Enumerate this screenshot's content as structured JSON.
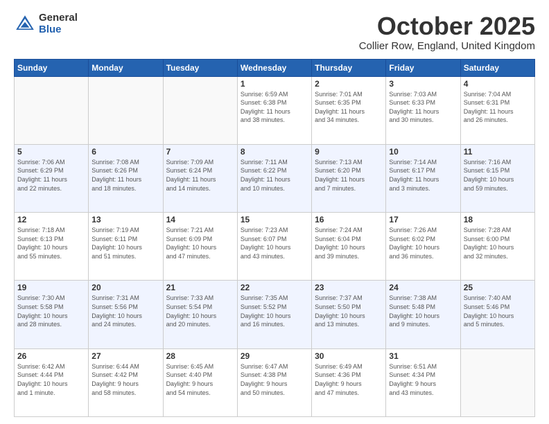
{
  "logo": {
    "general": "General",
    "blue": "Blue"
  },
  "header": {
    "month": "October 2025",
    "location": "Collier Row, England, United Kingdom"
  },
  "weekdays": [
    "Sunday",
    "Monday",
    "Tuesday",
    "Wednesday",
    "Thursday",
    "Friday",
    "Saturday"
  ],
  "weeks": [
    [
      {
        "day": "",
        "info": ""
      },
      {
        "day": "",
        "info": ""
      },
      {
        "day": "",
        "info": ""
      },
      {
        "day": "1",
        "info": "Sunrise: 6:59 AM\nSunset: 6:38 PM\nDaylight: 11 hours\nand 38 minutes."
      },
      {
        "day": "2",
        "info": "Sunrise: 7:01 AM\nSunset: 6:35 PM\nDaylight: 11 hours\nand 34 minutes."
      },
      {
        "day": "3",
        "info": "Sunrise: 7:03 AM\nSunset: 6:33 PM\nDaylight: 11 hours\nand 30 minutes."
      },
      {
        "day": "4",
        "info": "Sunrise: 7:04 AM\nSunset: 6:31 PM\nDaylight: 11 hours\nand 26 minutes."
      }
    ],
    [
      {
        "day": "5",
        "info": "Sunrise: 7:06 AM\nSunset: 6:29 PM\nDaylight: 11 hours\nand 22 minutes."
      },
      {
        "day": "6",
        "info": "Sunrise: 7:08 AM\nSunset: 6:26 PM\nDaylight: 11 hours\nand 18 minutes."
      },
      {
        "day": "7",
        "info": "Sunrise: 7:09 AM\nSunset: 6:24 PM\nDaylight: 11 hours\nand 14 minutes."
      },
      {
        "day": "8",
        "info": "Sunrise: 7:11 AM\nSunset: 6:22 PM\nDaylight: 11 hours\nand 10 minutes."
      },
      {
        "day": "9",
        "info": "Sunrise: 7:13 AM\nSunset: 6:20 PM\nDaylight: 11 hours\nand 7 minutes."
      },
      {
        "day": "10",
        "info": "Sunrise: 7:14 AM\nSunset: 6:17 PM\nDaylight: 11 hours\nand 3 minutes."
      },
      {
        "day": "11",
        "info": "Sunrise: 7:16 AM\nSunset: 6:15 PM\nDaylight: 10 hours\nand 59 minutes."
      }
    ],
    [
      {
        "day": "12",
        "info": "Sunrise: 7:18 AM\nSunset: 6:13 PM\nDaylight: 10 hours\nand 55 minutes."
      },
      {
        "day": "13",
        "info": "Sunrise: 7:19 AM\nSunset: 6:11 PM\nDaylight: 10 hours\nand 51 minutes."
      },
      {
        "day": "14",
        "info": "Sunrise: 7:21 AM\nSunset: 6:09 PM\nDaylight: 10 hours\nand 47 minutes."
      },
      {
        "day": "15",
        "info": "Sunrise: 7:23 AM\nSunset: 6:07 PM\nDaylight: 10 hours\nand 43 minutes."
      },
      {
        "day": "16",
        "info": "Sunrise: 7:24 AM\nSunset: 6:04 PM\nDaylight: 10 hours\nand 39 minutes."
      },
      {
        "day": "17",
        "info": "Sunrise: 7:26 AM\nSunset: 6:02 PM\nDaylight: 10 hours\nand 36 minutes."
      },
      {
        "day": "18",
        "info": "Sunrise: 7:28 AM\nSunset: 6:00 PM\nDaylight: 10 hours\nand 32 minutes."
      }
    ],
    [
      {
        "day": "19",
        "info": "Sunrise: 7:30 AM\nSunset: 5:58 PM\nDaylight: 10 hours\nand 28 minutes."
      },
      {
        "day": "20",
        "info": "Sunrise: 7:31 AM\nSunset: 5:56 PM\nDaylight: 10 hours\nand 24 minutes."
      },
      {
        "day": "21",
        "info": "Sunrise: 7:33 AM\nSunset: 5:54 PM\nDaylight: 10 hours\nand 20 minutes."
      },
      {
        "day": "22",
        "info": "Sunrise: 7:35 AM\nSunset: 5:52 PM\nDaylight: 10 hours\nand 16 minutes."
      },
      {
        "day": "23",
        "info": "Sunrise: 7:37 AM\nSunset: 5:50 PM\nDaylight: 10 hours\nand 13 minutes."
      },
      {
        "day": "24",
        "info": "Sunrise: 7:38 AM\nSunset: 5:48 PM\nDaylight: 10 hours\nand 9 minutes."
      },
      {
        "day": "25",
        "info": "Sunrise: 7:40 AM\nSunset: 5:46 PM\nDaylight: 10 hours\nand 5 minutes."
      }
    ],
    [
      {
        "day": "26",
        "info": "Sunrise: 6:42 AM\nSunset: 4:44 PM\nDaylight: 10 hours\nand 1 minute."
      },
      {
        "day": "27",
        "info": "Sunrise: 6:44 AM\nSunset: 4:42 PM\nDaylight: 9 hours\nand 58 minutes."
      },
      {
        "day": "28",
        "info": "Sunrise: 6:45 AM\nSunset: 4:40 PM\nDaylight: 9 hours\nand 54 minutes."
      },
      {
        "day": "29",
        "info": "Sunrise: 6:47 AM\nSunset: 4:38 PM\nDaylight: 9 hours\nand 50 minutes."
      },
      {
        "day": "30",
        "info": "Sunrise: 6:49 AM\nSunset: 4:36 PM\nDaylight: 9 hours\nand 47 minutes."
      },
      {
        "day": "31",
        "info": "Sunrise: 6:51 AM\nSunset: 4:34 PM\nDaylight: 9 hours\nand 43 minutes."
      },
      {
        "day": "",
        "info": ""
      }
    ]
  ]
}
